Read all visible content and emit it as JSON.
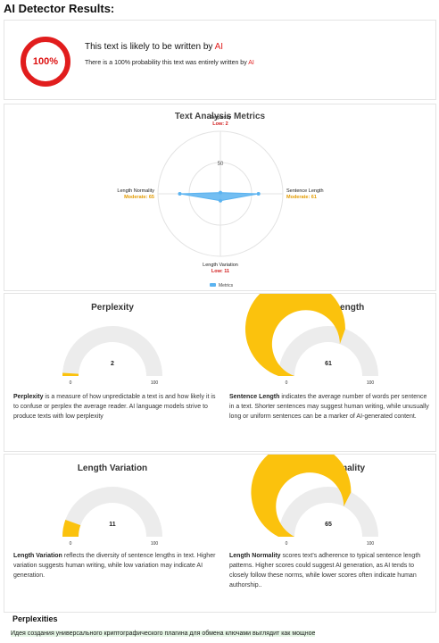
{
  "page_title": "AI Detector Results:",
  "result": {
    "percent_label": "100%",
    "headline_prefix": "This text is likely to be written by ",
    "headline_source": "AI",
    "sub_prefix": "There is a 100% probability this text was entirely written by ",
    "sub_source": "AI",
    "accent_color": "#e11d1d"
  },
  "metrics": {
    "title": "Text Analysis Metrics",
    "scale_label": "50",
    "legend_label": "Metrics",
    "series_color": "#5bb3f0",
    "axes": [
      {
        "name": "Perplexity",
        "level": "Low: 2",
        "level_color": "#d11c1c",
        "value": 2
      },
      {
        "name": "Sentence Length",
        "level": "Moderate: 61",
        "level_color": "#e39b00",
        "value": 61
      },
      {
        "name": "Length Variation",
        "level": "Low: 11",
        "level_color": "#d11c1c",
        "value": 11
      },
      {
        "name": "Length Normality",
        "level": "Moderate: 65",
        "level_color": "#e39b00",
        "value": 65
      }
    ]
  },
  "gauges": [
    {
      "title": "Perplexity",
      "value": 2,
      "value_label": "2",
      "min_label": "0",
      "max_label": "100",
      "desc_term": "Perplexity",
      "desc_rest": " is a measure of how unpredictable a text is and how likely it is to confuse or perplex the average reader. AI language models strive to produce texts with low perplexity"
    },
    {
      "title": "Sentence Length",
      "value": 61,
      "value_label": "61",
      "min_label": "0",
      "max_label": "100",
      "desc_term": "Sentence Length",
      "desc_rest": " indicates the average number of words per sentence in a text. Shorter sentences may suggest human writing, while unusually long or uniform sentences can be a marker of AI-generated content."
    },
    {
      "title": "Length Variation",
      "value": 11,
      "value_label": "11",
      "min_label": "0",
      "max_label": "100",
      "desc_term": "Length Variation",
      "desc_rest": " reflects the diversity of sentence lengths in text. Higher variation suggests human writing, while low variation may indicate AI generation."
    },
    {
      "title": "Length Normality",
      "value": 65,
      "value_label": "65",
      "min_label": "0",
      "max_label": "100",
      "desc_term": "Length Normality",
      "desc_rest": " scores text's adherence to typical sentence length patterns. Higher scores could suggest AI generation, as AI tends to closely follow these norms, while lower scores often indicate human authorship.."
    }
  ],
  "gauge_colors": {
    "fill": "#fbc20d",
    "track": "#ececec"
  },
  "perplexities": {
    "title": "Perplexities",
    "text": "Идея создания универсального криптографического плагина для обмена ключами выглядит как мощное"
  }
}
